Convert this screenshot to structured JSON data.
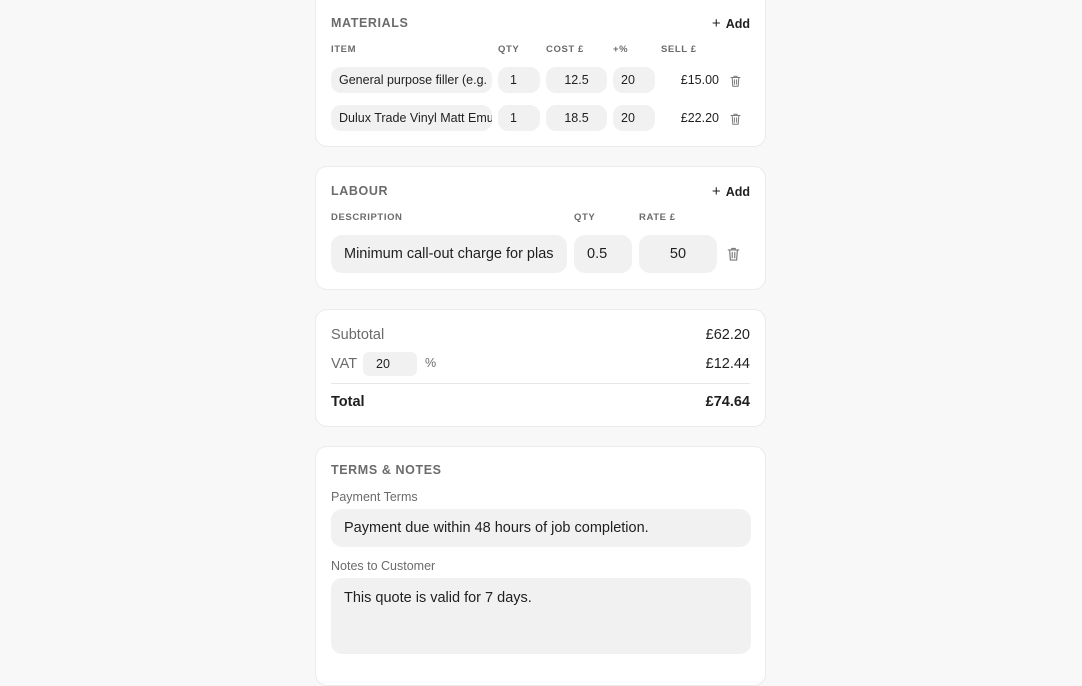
{
  "materials": {
    "title": "MATERIALS",
    "add_label": "Add",
    "headers": {
      "item": "ITEM",
      "qty": "QTY",
      "cost": "COST £",
      "markup": "+%",
      "sell": "SELL £"
    },
    "rows": [
      {
        "item": "General purpose filler (e.g.",
        "qty": "1",
        "cost": "12.5",
        "markup": "20",
        "sell": "£15.00"
      },
      {
        "item": "Dulux Trade Vinyl Matt Emu",
        "qty": "1",
        "cost": "18.5",
        "markup": "20",
        "sell": "£22.20"
      }
    ]
  },
  "labour": {
    "title": "LABOUR",
    "add_label": "Add",
    "headers": {
      "description": "DESCRIPTION",
      "qty": "QTY",
      "rate": "RATE £"
    },
    "rows": [
      {
        "description": "Minimum call-out charge for plas",
        "qty": "0.5",
        "rate": "50"
      }
    ]
  },
  "totals": {
    "subtotal_label": "Subtotal",
    "subtotal_value": "£62.20",
    "vat_label": "VAT",
    "vat_rate": "20",
    "vat_percent_sign": "%",
    "vat_value": "£12.44",
    "total_label": "Total",
    "total_value": "£74.64"
  },
  "terms": {
    "title": "TERMS & NOTES",
    "payment_terms_label": "Payment Terms",
    "payment_terms_value": "Payment due within 48 hours of job completion.",
    "notes_label": "Notes to Customer",
    "notes_value": "This quote is valid for 7 days."
  },
  "icons": {
    "add": "plus-icon",
    "delete": "trash-icon"
  },
  "colors": {
    "background": "#f8f8f8",
    "card": "#ffffff",
    "field": "#f1f1f1",
    "muted_text": "#6b6b6b",
    "text": "#1f1f1f"
  }
}
